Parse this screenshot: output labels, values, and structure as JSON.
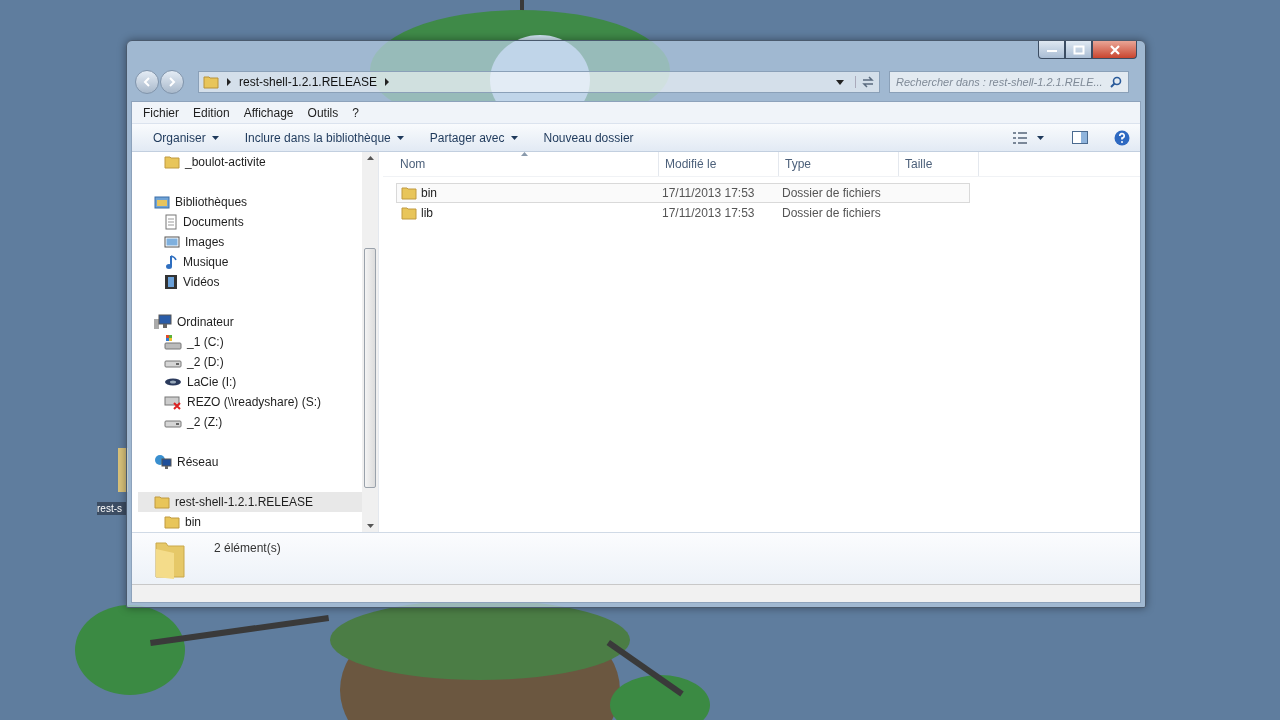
{
  "desktop": {
    "icon_label": "rest-s"
  },
  "address_bar": {
    "path": [
      "rest-shell-1.2.1.RELEASE"
    ]
  },
  "search": {
    "placeholder": "Rechercher dans : rest-shell-1.2.1.RELE..."
  },
  "menu": [
    "Fichier",
    "Edition",
    "Affichage",
    "Outils",
    "?"
  ],
  "toolbar": [
    {
      "label": "Organiser",
      "dropdown": true
    },
    {
      "label": "Inclure dans la bibliothèque",
      "dropdown": true
    },
    {
      "label": "Partager avec",
      "dropdown": true
    },
    {
      "label": "Nouveau dossier",
      "dropdown": false
    }
  ],
  "navigation": [
    {
      "children": [
        {
          "label": "_boulot-activite",
          "kind": "folder",
          "selected": false
        }
      ]
    },
    {
      "header": {
        "label": "Bibliothèques",
        "kind": "library",
        "selected": false
      },
      "children": [
        {
          "label": "Documents",
          "kind": "documents",
          "selected": false
        },
        {
          "label": "Images",
          "kind": "images",
          "selected": false
        },
        {
          "label": "Musique",
          "kind": "music",
          "selected": false
        },
        {
          "label": "Vidéos",
          "kind": "videos",
          "selected": false
        }
      ]
    },
    {
      "header": {
        "label": "Ordinateur",
        "kind": "computer",
        "selected": false
      },
      "children": [
        {
          "label": "_1 (C:)",
          "kind": "system-drive",
          "selected": false
        },
        {
          "label": "_2 (D:)",
          "kind": "drive",
          "selected": false
        },
        {
          "label": "LaCie (I:)",
          "kind": "external-drive",
          "selected": false
        },
        {
          "label": "REZO (\\\\readyshare) (S:)",
          "kind": "disconnected-drive",
          "selected": false
        },
        {
          "label": "_2 (Z:)",
          "kind": "drive",
          "selected": false
        }
      ]
    },
    {
      "header": {
        "label": "Réseau",
        "kind": "network",
        "selected": false
      }
    },
    {
      "header": {
        "label": "rest-shell-1.2.1.RELEASE",
        "kind": "folder",
        "selected": true
      },
      "children": [
        {
          "label": "bin",
          "kind": "folder",
          "selected": false
        }
      ]
    }
  ],
  "file_list": {
    "columns": [
      {
        "label": "Nom",
        "sorted": true
      },
      {
        "label": "Modifié le",
        "sorted": false
      },
      {
        "label": "Type",
        "sorted": false
      },
      {
        "label": "Taille",
        "sorted": false
      }
    ],
    "rows": [
      {
        "name": "bin",
        "modified": "17/11/2013 17:53",
        "type": "Dossier de fichiers",
        "hovered": true
      },
      {
        "name": "lib",
        "modified": "17/11/2013 17:53",
        "type": "Dossier de fichiers",
        "hovered": false
      }
    ]
  },
  "details": {
    "count": "2 élément(s)"
  }
}
